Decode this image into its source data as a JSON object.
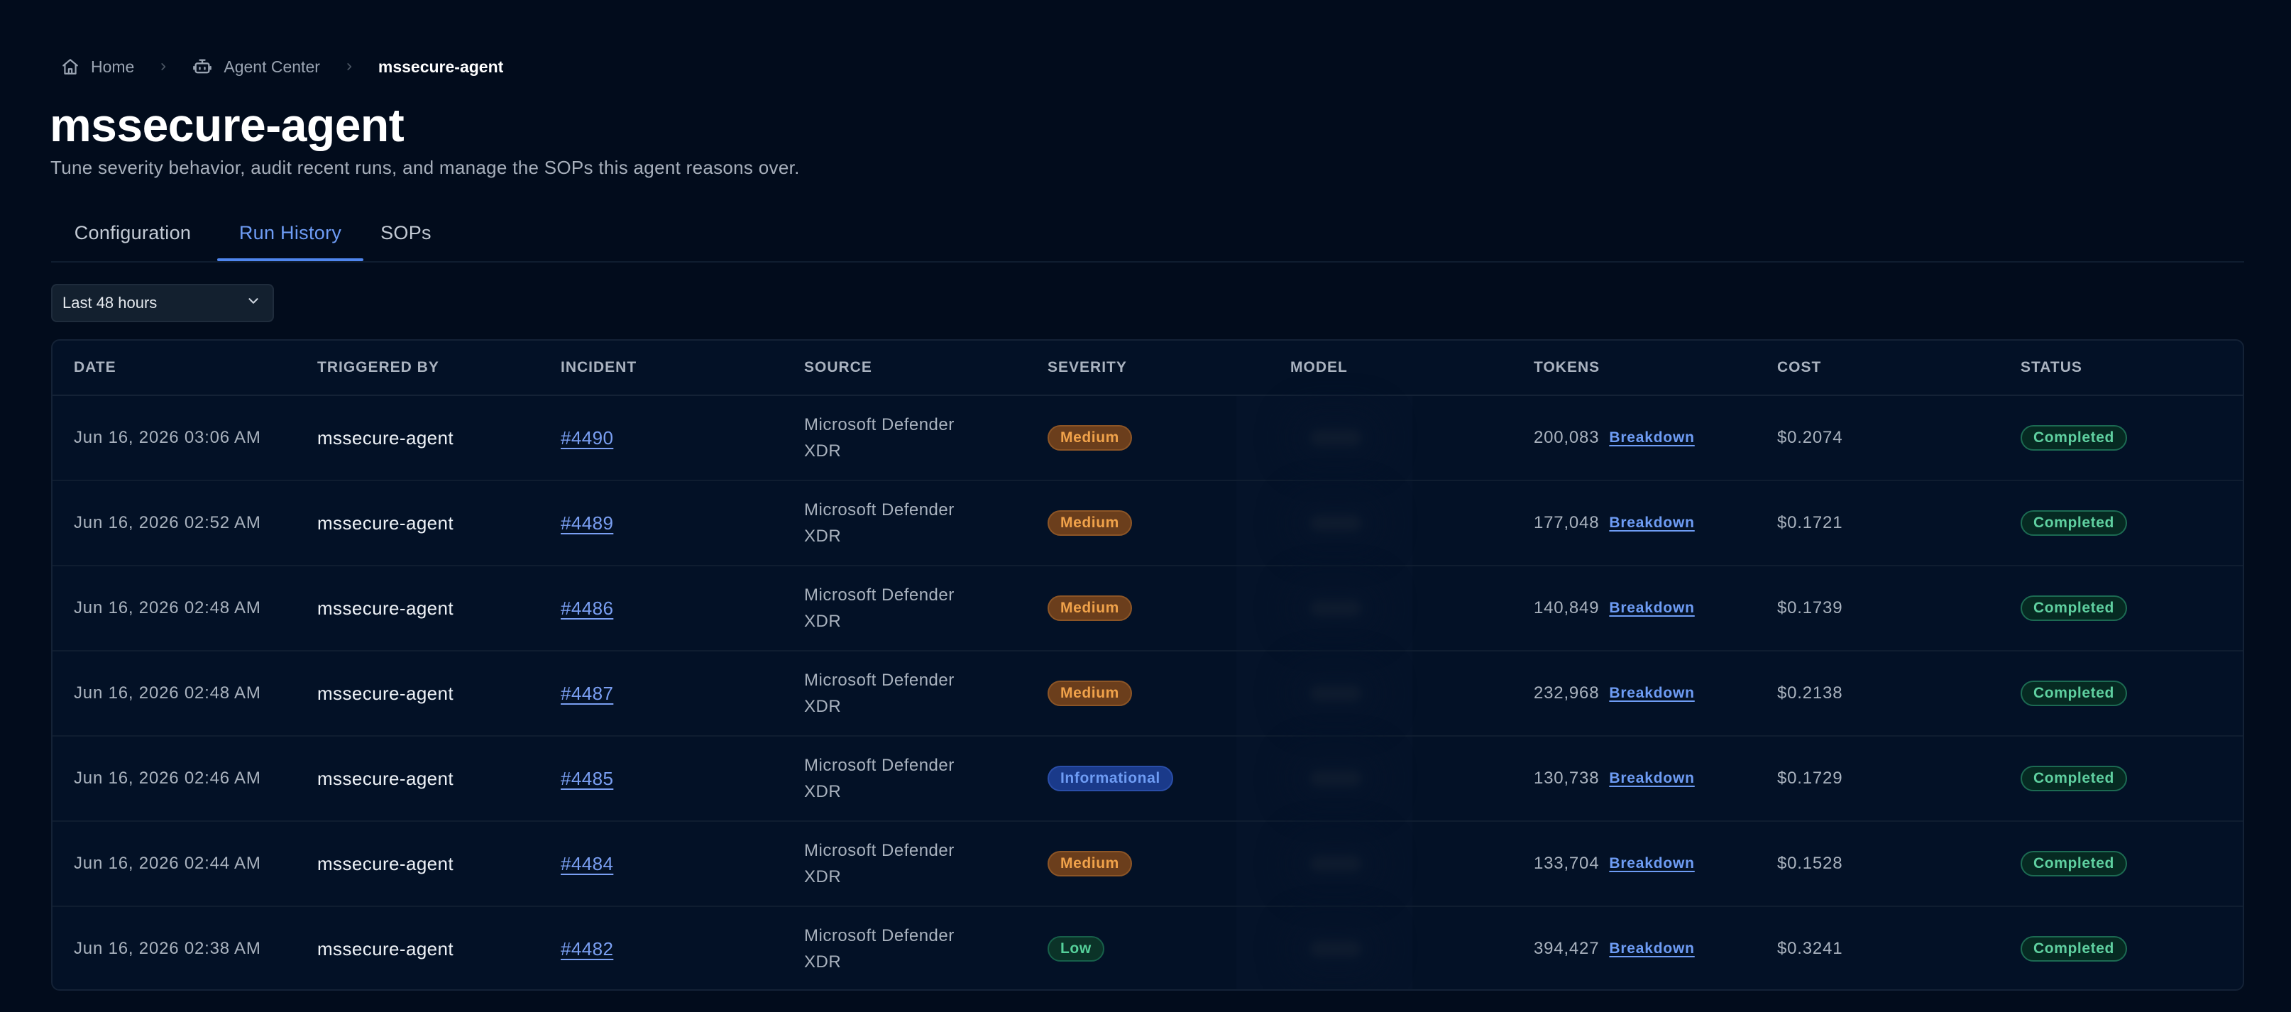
{
  "breadcrumb": {
    "home": "Home",
    "agent_center": "Agent Center",
    "current": "mssecure-agent"
  },
  "header": {
    "title": "mssecure-agent",
    "subtitle": "Tune severity behavior, audit recent runs, and manage the SOPs this agent reasons over."
  },
  "tabs": [
    "Configuration",
    "Run History",
    "SOPs"
  ],
  "active_tab": "Run History",
  "filter": {
    "selected": "Last 48 hours"
  },
  "table": {
    "columns": [
      "DATE",
      "TRIGGERED BY",
      "INCIDENT",
      "SOURCE",
      "SEVERITY",
      "MODEL",
      "TOKENS",
      "COST",
      "STATUS"
    ],
    "rows": [
      {
        "date": "Jun 16, 2026 03:06 AM",
        "triggered_by": "mssecure-agent",
        "incident": "#4490",
        "source_line1": "Microsoft Defender",
        "source_line2": "XDR",
        "severity": "Medium",
        "tokens": "200,083",
        "breakdown": "Breakdown",
        "cost": "$0.2074",
        "status": "Completed"
      },
      {
        "date": "Jun 16, 2026 02:52 AM",
        "triggered_by": "mssecure-agent",
        "incident": "#4489",
        "source_line1": "Microsoft Defender",
        "source_line2": "XDR",
        "severity": "Medium",
        "tokens": "177,048",
        "breakdown": "Breakdown",
        "cost": "$0.1721",
        "status": "Completed"
      },
      {
        "date": "Jun 16, 2026 02:48 AM",
        "triggered_by": "mssecure-agent",
        "incident": "#4486",
        "source_line1": "Microsoft Defender",
        "source_line2": "XDR",
        "severity": "Medium",
        "tokens": "140,849",
        "breakdown": "Breakdown",
        "cost": "$0.1739",
        "status": "Completed"
      },
      {
        "date": "Jun 16, 2026 02:48 AM",
        "triggered_by": "mssecure-agent",
        "incident": "#4487",
        "source_line1": "Microsoft Defender",
        "source_line2": "XDR",
        "severity": "Medium",
        "tokens": "232,968",
        "breakdown": "Breakdown",
        "cost": "$0.2138",
        "status": "Completed"
      },
      {
        "date": "Jun 16, 2026 02:46 AM",
        "triggered_by": "mssecure-agent",
        "incident": "#4485",
        "source_line1": "Microsoft Defender",
        "source_line2": "XDR",
        "severity": "Informational",
        "tokens": "130,738",
        "breakdown": "Breakdown",
        "cost": "$0.1729",
        "status": "Completed"
      },
      {
        "date": "Jun 16, 2026 02:44 AM",
        "triggered_by": "mssecure-agent",
        "incident": "#4484",
        "source_line1": "Microsoft Defender",
        "source_line2": "XDR",
        "severity": "Medium",
        "tokens": "133,704",
        "breakdown": "Breakdown",
        "cost": "$0.1528",
        "status": "Completed"
      },
      {
        "date": "Jun 16, 2026 02:38 AM",
        "triggered_by": "mssecure-agent",
        "incident": "#4482",
        "source_line1": "Microsoft Defender",
        "source_line2": "XDR",
        "severity": "Low",
        "tokens": "394,427",
        "breakdown": "Breakdown",
        "cost": "$0.3241",
        "status": "Completed"
      }
    ]
  },
  "colors": {
    "background": "#020c1c",
    "accent": "#4f86ee",
    "severity_medium": "#f0a24a",
    "severity_informational": "#6e9cf4",
    "severity_low": "#55d09a",
    "status_completed": "#5fd0a0"
  },
  "icons": {
    "home": "home-icon",
    "agent_center": "robot-icon",
    "separator": "chevron-right-icon",
    "dropdown": "chevron-down-icon"
  }
}
